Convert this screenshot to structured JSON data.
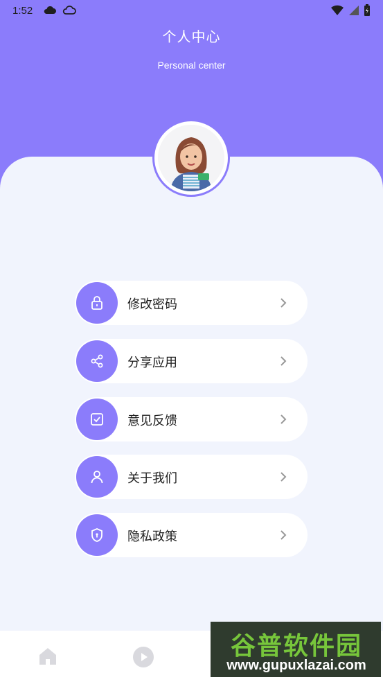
{
  "status_bar": {
    "time": "1:52",
    "left_icons": [
      "cloud-icon",
      "cloud-outline-icon"
    ],
    "right_icons": [
      "wifi-icon",
      "signal-icon",
      "battery-icon"
    ]
  },
  "header": {
    "title": "个人中心",
    "subtitle": "Personal center"
  },
  "menu": [
    {
      "label": "修改密码",
      "icon": "lock-icon"
    },
    {
      "label": "分享应用",
      "icon": "share-icon"
    },
    {
      "label": "意见反馈",
      "icon": "feedback-check-icon"
    },
    {
      "label": "关于我们",
      "icon": "user-icon"
    },
    {
      "label": "隐私政策",
      "icon": "shield-icon"
    }
  ],
  "bottom_nav": {
    "items": [
      {
        "icon": "home-icon"
      },
      {
        "icon": "play-icon"
      }
    ]
  },
  "watermark": {
    "title": "谷普软件园",
    "url": "www.gupuxlazai.com"
  },
  "colors": {
    "accent": "#8b7cfb",
    "background": "#f1f4fd",
    "card": "#ffffff"
  }
}
